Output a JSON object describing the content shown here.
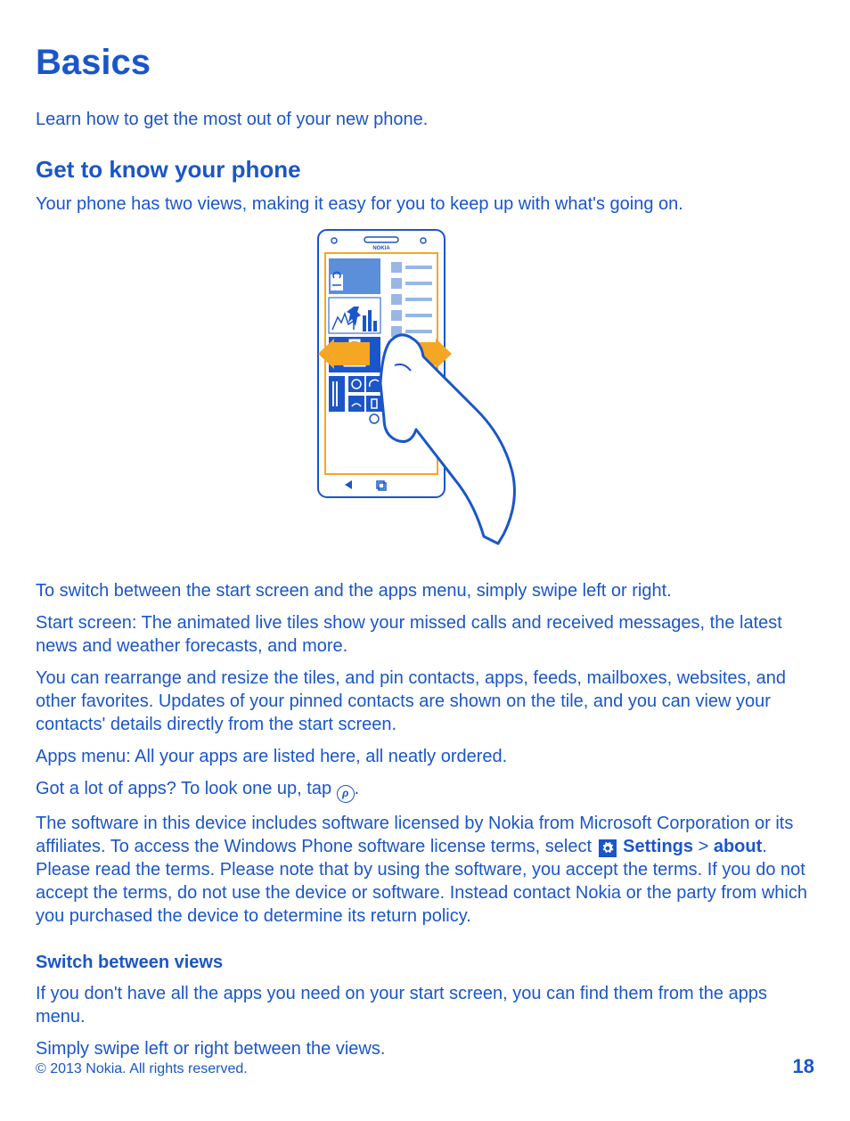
{
  "title": "Basics",
  "intro": "Learn how to get the most out of your new phone.",
  "section1": {
    "heading": "Get to know your phone",
    "lead": "Your phone has two views, making it easy for you to keep up with what's going on.",
    "p1": "To switch between the start screen and the apps menu, simply swipe left or right.",
    "p2": "Start screen: The animated live tiles show your missed calls and received messages, the latest news and weather forecasts, and more.",
    "p3": "You can rearrange and resize the tiles, and pin contacts, apps, feeds, mailboxes, websites, and other favorites. Updates of your pinned contacts are shown on the tile, and you can view your contacts' details directly from the start screen.",
    "p4": "Apps menu: All your apps are listed here, all neatly ordered.",
    "p5_pre": "Got a lot of apps? To look one up, tap ",
    "p5_post": ".",
    "p6_pre": "The software in this device includes software licensed by Nokia from Microsoft Corporation or its affiliates. To access the Windows Phone software license terms, select ",
    "p6_settings": "Settings",
    "p6_sep": " > ",
    "p6_about": "about",
    "p6_post": ". Please read the terms. Please note that by using the software, you accept the terms. If you do not accept the terms, do not use the device or software. Instead contact Nokia or the party from which you purchased the device to determine its return policy."
  },
  "section2": {
    "heading": "Switch between views",
    "p1": "If you don't have all the apps you need on your start screen, you can find them from the apps menu.",
    "p2": "Simply swipe left or right between the views."
  },
  "footer": {
    "copyright": "© 2013 Nokia. All rights reserved.",
    "page": "18"
  },
  "colors": {
    "primary": "#1a56c9",
    "accent": "#f5a623"
  }
}
